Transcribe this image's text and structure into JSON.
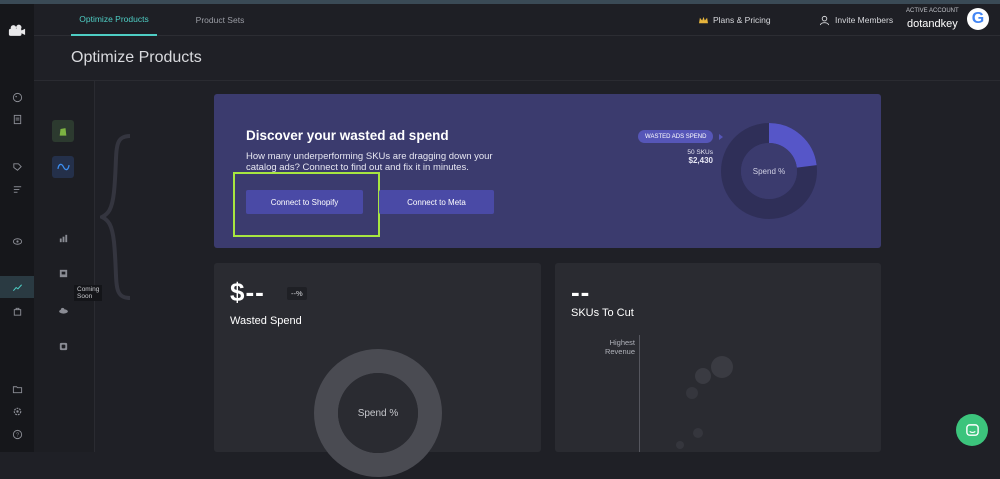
{
  "topbar": {
    "tabs": [
      {
        "label": "Optimize Products",
        "active": true
      },
      {
        "label": "Product Sets",
        "active": false
      }
    ],
    "plans_label": "Plans & Pricing",
    "invite_label": "Invite Members",
    "account_caption": "ACTIVE ACCOUNT",
    "account_name": "dotandkey",
    "account_logo": "G"
  },
  "page": {
    "title": "Optimize Products"
  },
  "subrail": {
    "coming_soon": "Coming Soon"
  },
  "hero": {
    "title": "Discover your wasted ad spend",
    "description": "How many underperforming SKUs are dragging down your catalog ads? Connect to find out and fix it in minutes.",
    "shopify_button": "Connect to Shopify",
    "meta_button": "Connect to Meta",
    "pill": "WASTED ADS SPEND",
    "sku_count": "50 SKUs",
    "sku_amount": "$2,430",
    "donut_label": "Spend %",
    "donut_fraction": 0.23
  },
  "wasted_card": {
    "value": "$--",
    "percent": "--%",
    "label": "Wasted Spend",
    "donut_label": "Spend %"
  },
  "skus_card": {
    "value": "--",
    "label": "SKUs To Cut",
    "axis_label_1": "Highest",
    "axis_label_2": "Revenue"
  },
  "colors": {
    "accent": "#4ecdc4",
    "hero_bg": "#3b3b6e",
    "button": "#4a4aa6",
    "highlight": "#a8e640",
    "chat": "#3cc47c"
  }
}
